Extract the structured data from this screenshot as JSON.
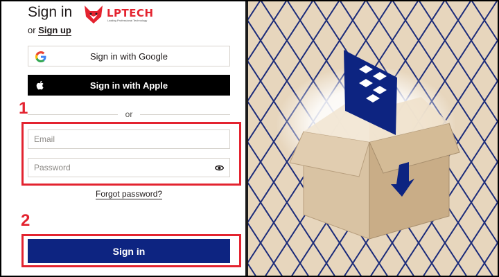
{
  "header": {
    "title": "Sign in",
    "or_text": "or",
    "signup_label": "Sign up"
  },
  "brand": {
    "name": "LPTECH",
    "tagline": "Lasting Professional Technology",
    "color": "#e4232f"
  },
  "social": {
    "google_label": "Sign in with Google",
    "apple_label": "Sign in with Apple",
    "google_icon": "google-g-icon",
    "apple_icon": "apple-icon"
  },
  "divider": {
    "label": "or"
  },
  "form": {
    "email_placeholder": "Email",
    "password_placeholder": "Password",
    "email_value": "",
    "password_value": "",
    "show_password_icon": "eye-icon",
    "forgot_label": "Forgot password?",
    "submit_label": "Sign in"
  },
  "annotations": {
    "step1": "1",
    "step2": "2",
    "color": "#e3232f"
  },
  "colors": {
    "primary_button": "#0d2481",
    "illustration_bg": "#e7d6bd",
    "grid_line": "#1b2b7a",
    "dropbox_blue": "#0d2481"
  }
}
